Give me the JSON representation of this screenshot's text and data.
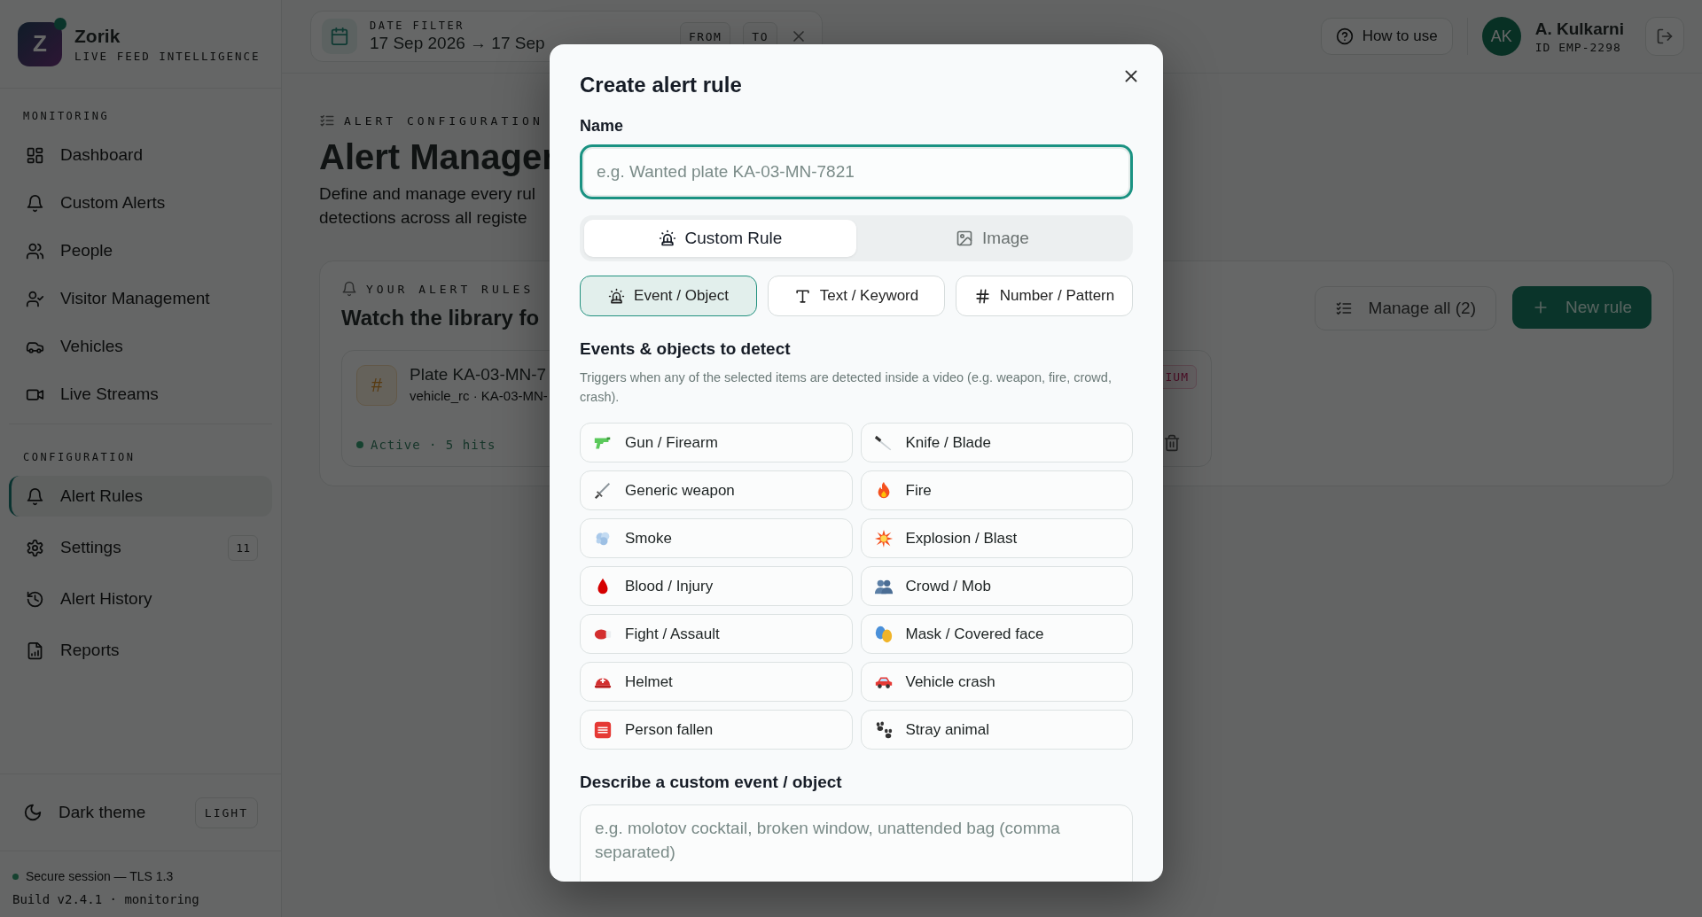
{
  "brand": {
    "logo_letter": "Z",
    "name": "Zorik",
    "tagline": "LIVE FEED INTELLIGENCE",
    "online": true
  },
  "sidebar": {
    "sections": [
      {
        "title": "MONITORING",
        "items": [
          {
            "label": "Dashboard",
            "selected": false
          },
          {
            "label": "Custom Alerts",
            "selected": false
          },
          {
            "label": "People",
            "selected": false
          },
          {
            "label": "Visitor Management",
            "selected": false
          },
          {
            "label": "Vehicles",
            "selected": false
          },
          {
            "label": "Live Streams",
            "selected": false
          }
        ]
      },
      {
        "title": "CONFIGURATION",
        "items": [
          {
            "label": "Alert Rules",
            "selected": true
          },
          {
            "label": "Settings",
            "selected": false,
            "badge": "11"
          },
          {
            "label": "Alert History",
            "selected": false
          },
          {
            "label": "Reports",
            "selected": false
          }
        ]
      }
    ],
    "theme_toggle": {
      "label": "Dark theme",
      "value": "LIGHT"
    },
    "footer": {
      "session": "Secure session — TLS 1.3",
      "build": "Build v2.4.1 · monitoring"
    }
  },
  "top_bar": {
    "date_filter": {
      "label": "DATE FILTER",
      "range": "17 Sep 2026 → 17 Sep",
      "buttons": [
        "FROM",
        "TO"
      ]
    },
    "help_button": "How to use",
    "user": {
      "initials": "AK",
      "name": "A. Kulkarni",
      "id": "ID EMP-2298"
    }
  },
  "content": {
    "eyebrow": "ALERT CONFIGURATION",
    "title": "Alert Manager",
    "description": [
      "Define and manage every rul",
      "detections across all registe"
    ],
    "rules_card": {
      "eyebrow": "YOUR ALERT RULES",
      "title": "Watch the library fo",
      "manage_button": "Manage all (2)",
      "new_button": "New rule",
      "rule": {
        "icon_char": "#",
        "title": "Plate KA-03-MN-7",
        "meta": "vehicle_rc · KA-03-MN-",
        "status": "Active · 5 hits",
        "active": true,
        "severity": "IUM"
      }
    }
  },
  "modal": {
    "title": "Create alert rule",
    "name_label": "Name",
    "name_placeholder": "e.g. Wanted plate KA-03-MN-7821",
    "modes": [
      {
        "label": "Custom Rule",
        "selected": true
      },
      {
        "label": "Image",
        "selected": false
      }
    ],
    "rule_types": [
      {
        "label": "Event / Object",
        "selected": true
      },
      {
        "label": "Text / Keyword",
        "selected": false
      },
      {
        "label": "Number / Pattern",
        "selected": false
      }
    ],
    "section_title": "Events & objects to detect",
    "help": "Triggers when any of the selected items are detected inside a video (e.g. weapon, fire, crowd, crash).",
    "items": [
      {
        "label": "Gun / Firearm",
        "selected": false
      },
      {
        "label": "Knife / Blade",
        "selected": false
      },
      {
        "label": "Generic weapon",
        "selected": false
      },
      {
        "label": "Fire",
        "selected": false
      },
      {
        "label": "Smoke",
        "selected": false
      },
      {
        "label": "Explosion / Blast",
        "selected": false
      },
      {
        "label": "Blood / Injury",
        "selected": false
      },
      {
        "label": "Crowd / Mob",
        "selected": false
      },
      {
        "label": "Fight / Assault",
        "selected": false
      },
      {
        "label": "Mask / Covered face",
        "selected": false
      },
      {
        "label": "Helmet",
        "selected": false
      },
      {
        "label": "Vehicle crash",
        "selected": false
      },
      {
        "label": "Person fallen",
        "selected": false
      },
      {
        "label": "Stray animal",
        "selected": false
      }
    ],
    "custom_label": "Describe a custom event / object",
    "custom_placeholder": "e.g. molotov cocktail, broken window, unattended bag (comma separated)"
  }
}
